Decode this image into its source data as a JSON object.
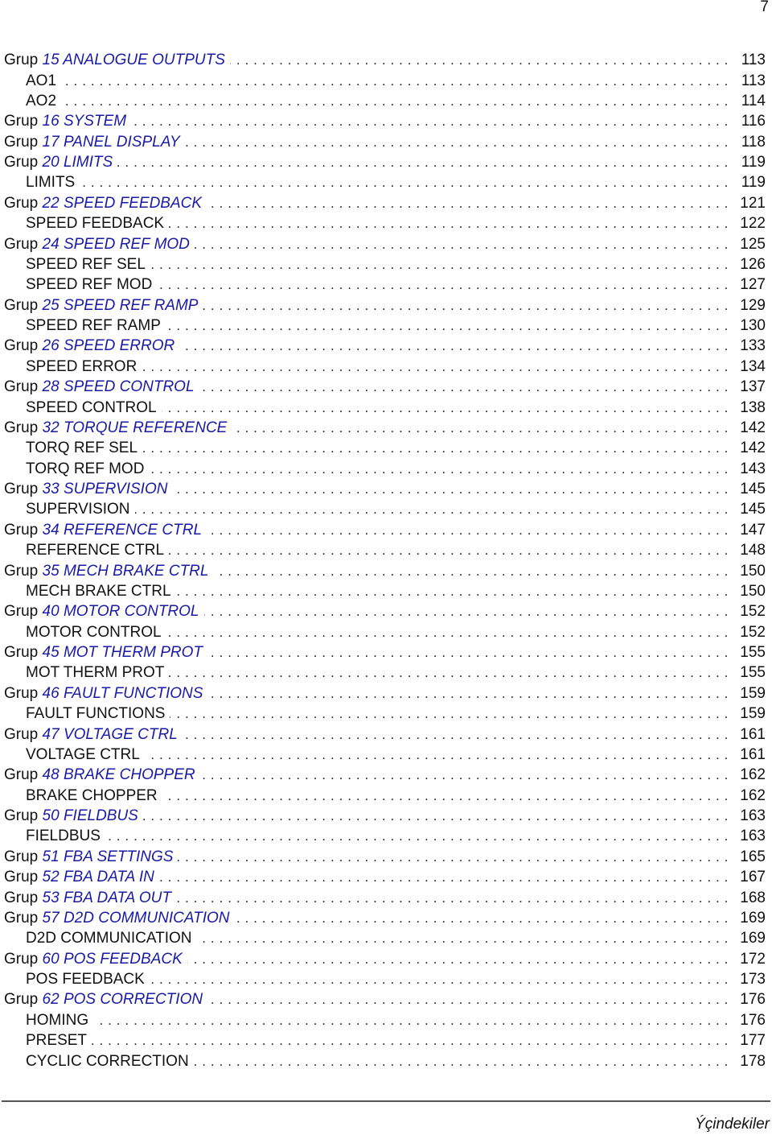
{
  "page": {
    "number": "7",
    "footer_title": "Ýçindekiler",
    "link_color": "#1a1aa6"
  },
  "toc": {
    "entries": [
      {
        "level": 1,
        "prefix": "Grup",
        "label": "15 ANALOGUE OUTPUTS",
        "page": "113"
      },
      {
        "level": 2,
        "label": "AO1",
        "page": "113"
      },
      {
        "level": 2,
        "label": "AO2",
        "page": "114"
      },
      {
        "level": 1,
        "prefix": "Grup",
        "label": "16 SYSTEM",
        "page": "116"
      },
      {
        "level": 1,
        "prefix": "Grup",
        "label": "17 PANEL DISPLAY",
        "page": "118"
      },
      {
        "level": 1,
        "prefix": "Grup",
        "label": "20 LIMITS",
        "page": "119"
      },
      {
        "level": 2,
        "label": "LIMITS",
        "page": "119"
      },
      {
        "level": 1,
        "prefix": "Grup",
        "label": "22 SPEED FEEDBACK",
        "page": "121"
      },
      {
        "level": 2,
        "label": "SPEED FEEDBACK",
        "page": "122"
      },
      {
        "level": 1,
        "prefix": "Grup",
        "label": "24 SPEED REF MOD",
        "page": "125"
      },
      {
        "level": 2,
        "label": "SPEED REF SEL",
        "page": "126"
      },
      {
        "level": 2,
        "label": "SPEED REF MOD",
        "page": "127"
      },
      {
        "level": 1,
        "prefix": "Grup",
        "label": "25 SPEED REF RAMP",
        "page": "129"
      },
      {
        "level": 2,
        "label": "SPEED REF RAMP",
        "page": "130"
      },
      {
        "level": 1,
        "prefix": "Grup",
        "label": "26 SPEED ERROR",
        "page": "133"
      },
      {
        "level": 2,
        "label": "SPEED ERROR",
        "page": "134"
      },
      {
        "level": 1,
        "prefix": "Grup",
        "label": "28 SPEED CONTROL",
        "page": "137"
      },
      {
        "level": 2,
        "label": "SPEED CONTROL",
        "page": "138"
      },
      {
        "level": 1,
        "prefix": "Grup",
        "label": "32 TORQUE REFERENCE",
        "page": "142"
      },
      {
        "level": 2,
        "label": "TORQ REF SEL",
        "page": "142"
      },
      {
        "level": 2,
        "label": "TORQ REF MOD",
        "page": "143"
      },
      {
        "level": 1,
        "prefix": "Grup",
        "label": "33 SUPERVISION",
        "page": "145"
      },
      {
        "level": 2,
        "label": "SUPERVISION",
        "page": "145"
      },
      {
        "level": 1,
        "prefix": "Grup",
        "label": "34 REFERENCE CTRL",
        "page": "147"
      },
      {
        "level": 2,
        "label": "REFERENCE CTRL",
        "page": "148"
      },
      {
        "level": 1,
        "prefix": "Grup",
        "label": "35 MECH BRAKE CTRL",
        "page": "150"
      },
      {
        "level": 2,
        "label": "MECH BRAKE CTRL",
        "page": "150"
      },
      {
        "level": 1,
        "prefix": "Grup",
        "label": "40 MOTOR CONTROL",
        "page": "152"
      },
      {
        "level": 2,
        "label": "MOTOR CONTROL",
        "page": "152"
      },
      {
        "level": 1,
        "prefix": "Grup",
        "label": "45 MOT THERM PROT",
        "page": "155"
      },
      {
        "level": 2,
        "label": "MOT THERM PROT",
        "page": "155"
      },
      {
        "level": 1,
        "prefix": "Grup",
        "label": "46 FAULT FUNCTIONS",
        "page": "159"
      },
      {
        "level": 2,
        "label": "FAULT FUNCTIONS",
        "page": "159"
      },
      {
        "level": 1,
        "prefix": "Grup",
        "label": "47 VOLTAGE CTRL",
        "page": "161"
      },
      {
        "level": 2,
        "label": "VOLTAGE CTRL",
        "page": "161"
      },
      {
        "level": 1,
        "prefix": "Grup",
        "label": "48 BRAKE CHOPPER",
        "page": "162"
      },
      {
        "level": 2,
        "label": "BRAKE CHOPPER",
        "page": "162"
      },
      {
        "level": 1,
        "prefix": "Grup",
        "label": "50 FIELDBUS",
        "page": "163"
      },
      {
        "level": 2,
        "label": "FIELDBUS",
        "page": "163"
      },
      {
        "level": 1,
        "prefix": "Grup",
        "label": "51 FBA SETTINGS",
        "page": "165"
      },
      {
        "level": 1,
        "prefix": "Grup",
        "label": "52 FBA DATA IN",
        "page": "167"
      },
      {
        "level": 1,
        "prefix": "Grup",
        "label": "53 FBA DATA OUT",
        "page": "168"
      },
      {
        "level": 1,
        "prefix": "Grup",
        "label": "57 D2D COMMUNICATION",
        "page": "169"
      },
      {
        "level": 2,
        "label": "D2D COMMUNICATION",
        "page": "169"
      },
      {
        "level": 1,
        "prefix": "Grup",
        "label": "60 POS FEEDBACK",
        "page": "172"
      },
      {
        "level": 2,
        "label": "POS FEEDBACK",
        "page": "173"
      },
      {
        "level": 1,
        "prefix": "Grup",
        "label": "62 POS CORRECTION",
        "page": "176"
      },
      {
        "level": 2,
        "label": "HOMING",
        "page": "176"
      },
      {
        "level": 2,
        "label": "PRESET",
        "page": "177"
      },
      {
        "level": 2,
        "label": "CYCLIC CORRECTION",
        "page": "178"
      }
    ]
  }
}
